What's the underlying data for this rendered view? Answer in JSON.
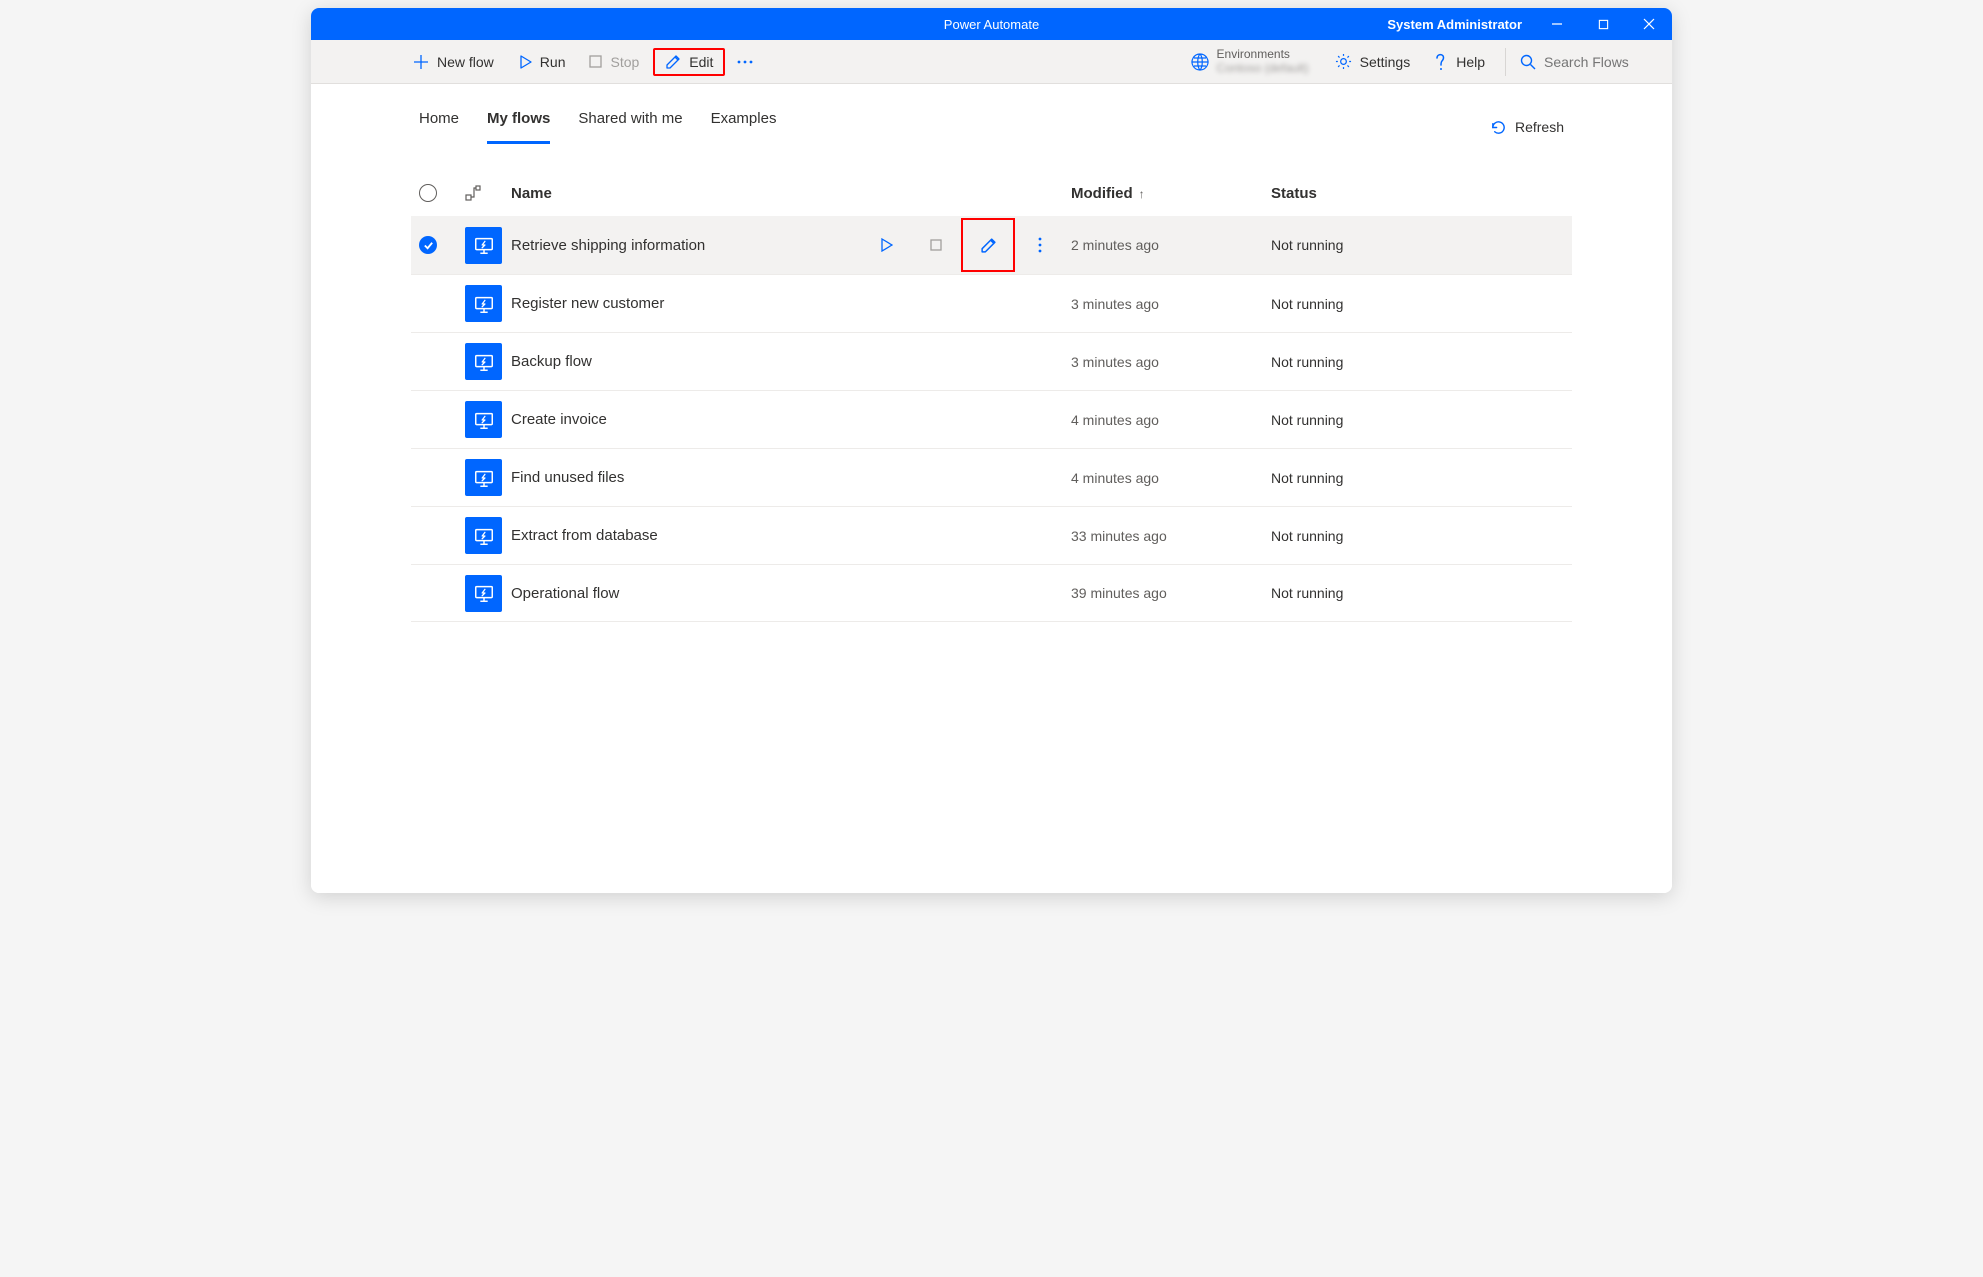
{
  "titlebar": {
    "app_title": "Power Automate",
    "user_name": "System Administrator"
  },
  "commandbar": {
    "new_flow": "New flow",
    "run": "Run",
    "stop": "Stop",
    "edit": "Edit",
    "environments_label": "Environments",
    "environment_name": "Contoso (default)",
    "settings": "Settings",
    "help": "Help",
    "search_placeholder": "Search Flows"
  },
  "tabs": {
    "home": "Home",
    "my_flows": "My flows",
    "shared": "Shared with me",
    "examples": "Examples"
  },
  "refresh_label": "Refresh",
  "columns": {
    "name": "Name",
    "modified": "Modified",
    "status": "Status"
  },
  "flows": [
    {
      "name": "Retrieve shipping information",
      "modified": "2 minutes ago",
      "status": "Not running",
      "selected": true
    },
    {
      "name": "Register new customer",
      "modified": "3 minutes ago",
      "status": "Not running",
      "selected": false
    },
    {
      "name": "Backup flow",
      "modified": "3 minutes ago",
      "status": "Not running",
      "selected": false
    },
    {
      "name": "Create invoice",
      "modified": "4 minutes ago",
      "status": "Not running",
      "selected": false
    },
    {
      "name": "Find unused files",
      "modified": "4 minutes ago",
      "status": "Not running",
      "selected": false
    },
    {
      "name": "Extract from database",
      "modified": "33 minutes ago",
      "status": "Not running",
      "selected": false
    },
    {
      "name": "Operational flow",
      "modified": "39 minutes ago",
      "status": "Not running",
      "selected": false
    }
  ]
}
